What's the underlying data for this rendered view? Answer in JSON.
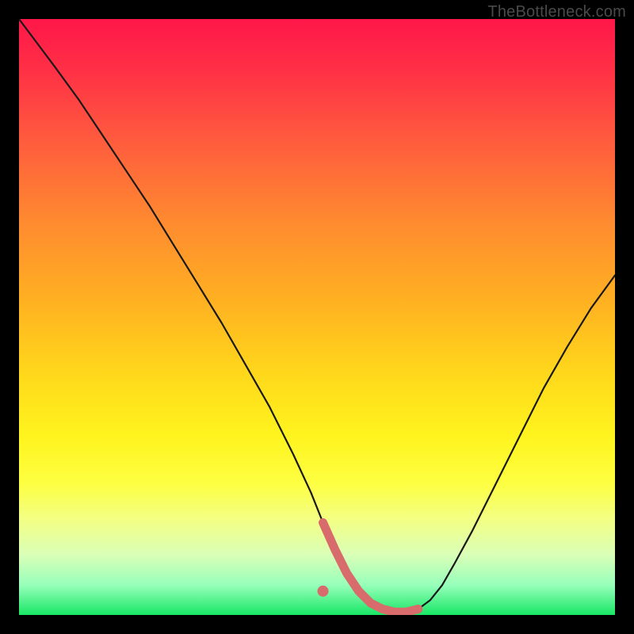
{
  "watermark": "TheBottleneck.com",
  "colors": {
    "curve_stroke": "#1a1a1a",
    "marker_stroke": "#d86b6b",
    "marker_fill": "#d86b6b",
    "background": "#000000"
  },
  "chart_data": {
    "type": "line",
    "title": "",
    "xlabel": "",
    "ylabel": "",
    "xlim": [
      0,
      100
    ],
    "ylim": [
      0,
      100
    ],
    "grid": false,
    "series": [
      {
        "name": "bottleneck-curve",
        "x": [
          0,
          3,
          6,
          10,
          14,
          18,
          22,
          26,
          30,
          34,
          38,
          42,
          46,
          49,
          51,
          53,
          55,
          57,
          59,
          61,
          63,
          65,
          67,
          69,
          71,
          73,
          76,
          80,
          84,
          88,
          92,
          96,
          100
        ],
        "y": [
          100,
          96,
          92,
          86.5,
          80.5,
          74.5,
          68.5,
          62,
          55.5,
          49,
          42,
          35,
          27,
          20.5,
          15.5,
          11,
          7,
          4,
          2,
          1,
          0.5,
          0.5,
          1,
          2.5,
          5,
          8.5,
          14,
          22,
          30,
          38,
          45,
          51.5,
          57
        ]
      }
    ],
    "markers": {
      "name": "optimal-range",
      "x_start": 51,
      "x_end": 67,
      "y": 1,
      "dot": {
        "x": 51,
        "y": 4
      }
    }
  }
}
